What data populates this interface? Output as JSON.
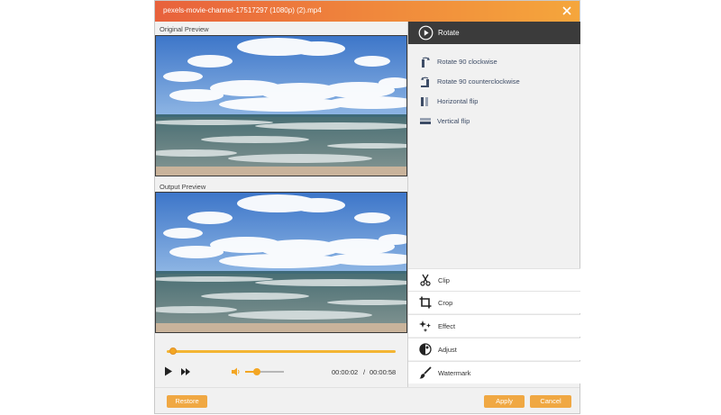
{
  "window": {
    "title": "pexels-movie-channel-17517297 (1080p) (2).mp4"
  },
  "previews": {
    "original_label": "Original Preview",
    "output_label": "Output Preview"
  },
  "player": {
    "current_time": "00:00:02",
    "separator": "/",
    "total_time": "00:00:58",
    "progress": 0.02,
    "volume": 0.3
  },
  "rotate": {
    "header": "Rotate",
    "items": [
      {
        "label": "Rotate 90 clockwise",
        "icon": "rotate-cw-icon"
      },
      {
        "label": "Rotate 90 counterclockwise",
        "icon": "rotate-ccw-icon"
      },
      {
        "label": "Horizontal flip",
        "icon": "horizontal-flip-icon"
      },
      {
        "label": "Vertical flip",
        "icon": "vertical-flip-icon"
      }
    ]
  },
  "tools": [
    {
      "label": "Clip",
      "icon": "scissors-icon"
    },
    {
      "label": "Crop",
      "icon": "crop-icon"
    },
    {
      "label": "Effect",
      "icon": "sparkle-icon"
    },
    {
      "label": "Adjust",
      "icon": "adjust-icon"
    },
    {
      "label": "Watermark",
      "icon": "brush-icon"
    }
  ],
  "footer": {
    "restore": "Restore",
    "apply": "Apply",
    "cancel": "Cancel"
  },
  "colors": {
    "accent": "#f0a843",
    "title_gradient_start": "#e8613c",
    "title_gradient_end": "#f5a63c",
    "panel_header": "#3b3b3b"
  }
}
